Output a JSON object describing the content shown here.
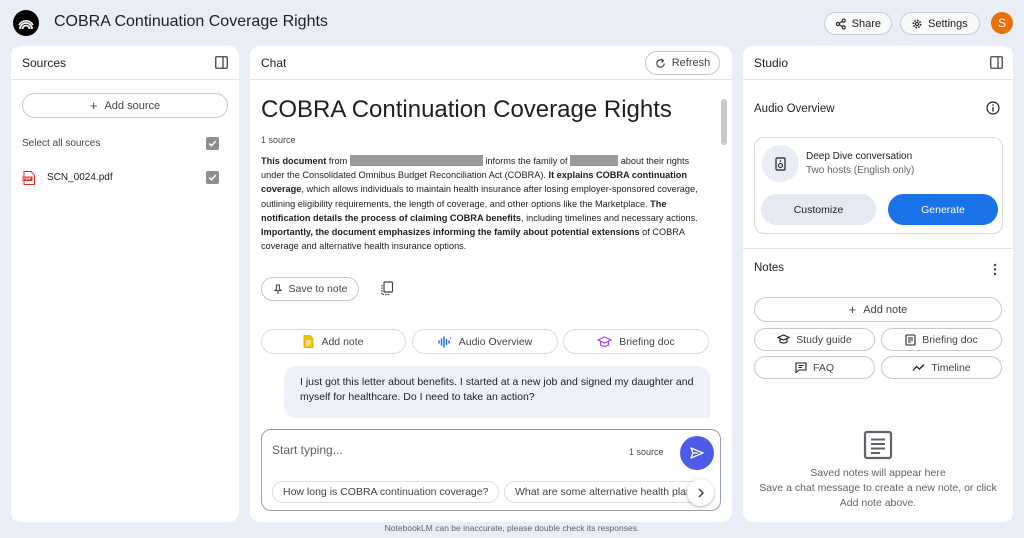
{
  "header": {
    "title": "COBRA Continuation Coverage Rights",
    "share_label": "Share",
    "settings_label": "Settings",
    "avatar_initial": "S"
  },
  "sources_panel": {
    "title": "Sources",
    "add_source_label": "Add source",
    "select_all_label": "Select all sources",
    "items": [
      {
        "name": "SCN_0024.pdf",
        "icon": "pdf-icon",
        "checked": true
      }
    ]
  },
  "chat_panel": {
    "title": "Chat",
    "refresh_label": "Refresh",
    "notebook_title": "COBRA Continuation Coverage Rights",
    "source_count": "1 source",
    "summary": {
      "p1_bold": "This document",
      "p2": " from ",
      "p3": " informs the family of ",
      "p4": " about their rights under the Consolidated Omnibus Budget Reconciliation Act (COBRA). ",
      "p5_bold": "It explains COBRA continuation coverage",
      "p6": ", which allows individuals to maintain health insurance after losing employer-sponsored coverage, outlining eligibility requirements, the length of coverage, and other options like the Marketplace. ",
      "p7_bold": "The notification details the process of claiming COBRA benefits",
      "p8": ", including timelines and necessary actions. ",
      "p9_bold": "Importantly, the document emphasizes informing the family about potential extensions",
      "p10": " of COBRA coverage and alternative health insurance options."
    },
    "save_to_note_label": "Save to note",
    "suggestion_buttons": [
      {
        "label": "Add note",
        "icon": "note-add-icon"
      },
      {
        "label": "Audio Overview",
        "icon": "audio-wave-icon"
      },
      {
        "label": "Briefing doc",
        "icon": "briefing-cap-icon"
      }
    ],
    "user_message": "I just got this letter about benefits.  I started at a new job and signed my daughter and myself for healthcare.  Do I need to take an action?",
    "input": {
      "placeholder": "Start typing...",
      "value": "",
      "source_count": "1 source"
    },
    "suggested_questions": [
      "How long is COBRA continuation coverage?",
      "What are some alternative health plans?"
    ]
  },
  "studio_panel": {
    "title": "Studio",
    "audio_overview_title": "Audio Overview",
    "audio_card": {
      "title": "Deep Dive conversation",
      "subtitle": "Two hosts (English only)",
      "customize_label": "Customize",
      "generate_label": "Generate"
    },
    "notes_title": "Notes",
    "add_note_label": "Add note",
    "note_buttons": [
      {
        "label": "Study guide",
        "icon": "study-cap-icon"
      },
      {
        "label": "Briefing doc",
        "icon": "briefing-doc-icon"
      },
      {
        "label": "FAQ",
        "icon": "faq-icon"
      },
      {
        "label": "Timeline",
        "icon": "timeline-icon"
      }
    ],
    "empty_title": "Saved notes will appear here",
    "empty_subtitle": "Save a chat message to create a new note, or click Add note above."
  },
  "footer": {
    "disclaimer": "NotebookLM can be inaccurate, please double check its responses."
  },
  "colors": {
    "background": "#e9eef6",
    "primary_button": "#1a73e8",
    "send_button": "#4c5be8",
    "avatar": "#e8710a",
    "pdf_red": "#d93025",
    "redaction": "#9a9a9a"
  }
}
